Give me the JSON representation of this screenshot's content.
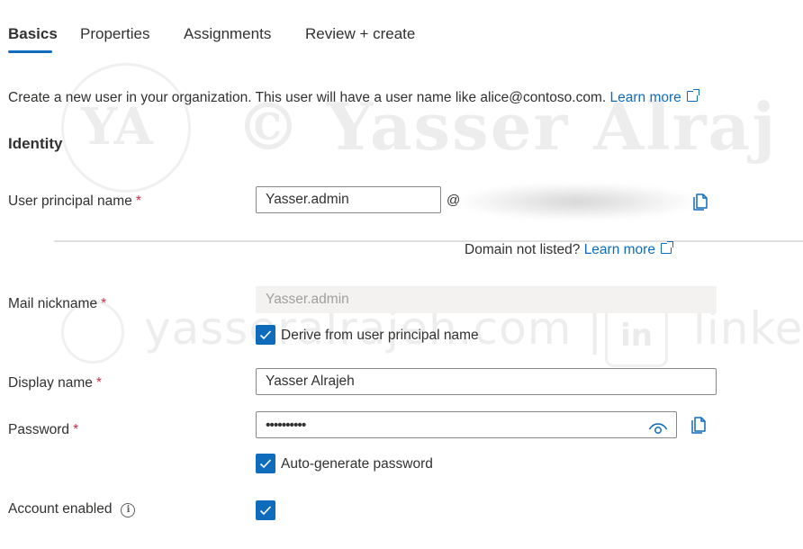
{
  "tabs": [
    {
      "label": "Basics",
      "active": true
    },
    {
      "label": "Properties",
      "active": false
    },
    {
      "label": "Assignments",
      "active": false
    },
    {
      "label": "Review + create",
      "active": false
    }
  ],
  "intro": {
    "text": "Create a new user in your organization. This user will have a user name like alice@contoso.com.",
    "link": "Learn more"
  },
  "section_title": "Identity",
  "required_marker": "*",
  "fields": {
    "upn": {
      "label": "User principal name",
      "value": "Yasser.admin",
      "at": "@"
    },
    "domain_note": {
      "text": "Domain not listed?",
      "link": "Learn more"
    },
    "mail_nickname": {
      "label": "Mail nickname",
      "value": "Yasser.admin",
      "derive_label": "Derive from user principal name",
      "derive_checked": true
    },
    "display_name": {
      "label": "Display name",
      "value": "Yasser Alrajeh"
    },
    "password": {
      "label": "Password",
      "value": "••••••••••",
      "auto_label": "Auto-generate password",
      "auto_checked": true
    },
    "account_enabled": {
      "label": "Account enabled",
      "checked": true
    }
  },
  "watermark": {
    "brand": "YA © Yasser Alraj",
    "url": "yasseralrajeh.com  |",
    "linked": "linked",
    "ya": "YA",
    "in": "in"
  },
  "colors": {
    "accent": "#0f6cbd",
    "required": "#c4314b",
    "text": "#323130"
  },
  "icons": [
    "copy-icon",
    "eye-icon",
    "info-icon",
    "external-link-icon",
    "checkmark-icon"
  ]
}
